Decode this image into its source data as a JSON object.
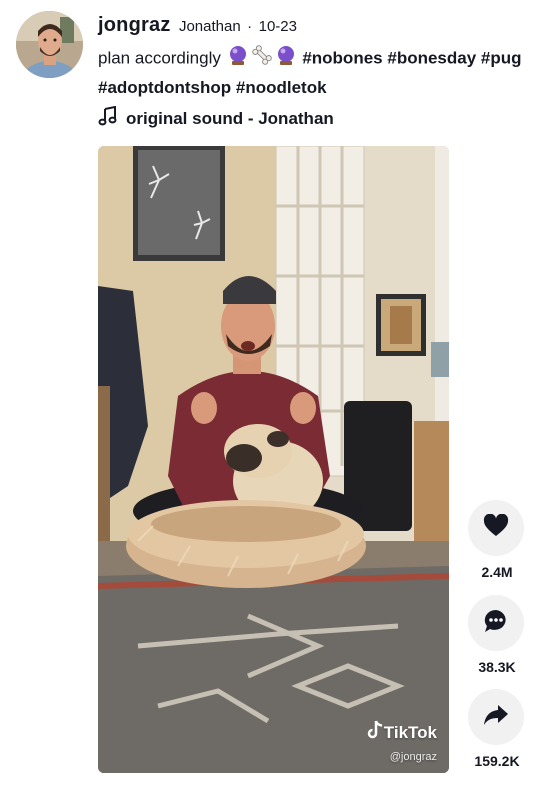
{
  "post": {
    "username": "jongraz",
    "nickname": "Jonathan",
    "separator": "·",
    "date": "10-23",
    "caption_text": "plan accordingly",
    "hashtags_line1": [
      "#nobones",
      "#bonesday",
      "#pug"
    ],
    "hashtags_line2": [
      "#adoptdontshop",
      "#noodletok"
    ],
    "caption_emojis": [
      "crystal-ball",
      "bone",
      "crystal-ball"
    ],
    "sound": "original sound - Jonathan"
  },
  "video": {
    "watermark_logo": "TikTok",
    "watermark_user": "@jongraz"
  },
  "actions": {
    "likes": "2.4M",
    "comments": "38.3K",
    "shares": "159.2K"
  },
  "icons": {
    "like": "heart-icon",
    "comment": "comment-icon",
    "share": "share-icon",
    "music": "music-note-icon"
  },
  "colors": {
    "text": "#161823",
    "action_bg": "#f1f1f2"
  }
}
